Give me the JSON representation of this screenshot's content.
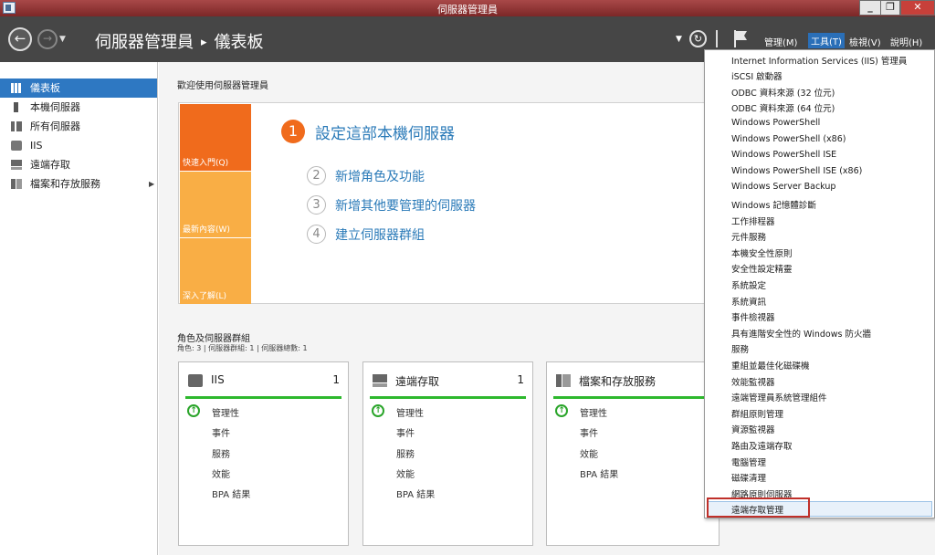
{
  "window": {
    "title": "伺服器管理員"
  },
  "header": {
    "app_name": "伺服器管理員",
    "separator": "▸",
    "page": "儀表板",
    "menus": {
      "manage": "管理(M)",
      "tools": "工具(T)",
      "view": "檢視(V)",
      "help": "說明(H)"
    }
  },
  "sidebar": {
    "items": [
      {
        "label": "儀表板"
      },
      {
        "label": "本機伺服器"
      },
      {
        "label": "所有伺服器"
      },
      {
        "label": "IIS"
      },
      {
        "label": "遠端存取"
      },
      {
        "label": "檔案和存放服務"
      }
    ]
  },
  "welcome": {
    "title": "歡迎使用伺服器管理員",
    "tiles": {
      "quick": "快速入門(Q)",
      "new": "最新內容(W)",
      "learn": "深入了解(L)"
    },
    "steps": [
      {
        "num": "1",
        "text": "設定這部本機伺服器"
      },
      {
        "num": "2",
        "text": "新增角色及功能"
      },
      {
        "num": "3",
        "text": "新增其他要管理的伺服器"
      },
      {
        "num": "4",
        "text": "建立伺服器群組"
      }
    ]
  },
  "roles": {
    "title": "角色及伺服器群組",
    "subtitle": "角色: 3 | 伺服器群組: 1 | 伺服器總數: 1",
    "cards": [
      {
        "name": "IIS",
        "count": "1",
        "rows": [
          "管理性",
          "事件",
          "服務",
          "效能",
          "BPA 結果"
        ]
      },
      {
        "name": "遠端存取",
        "count": "1",
        "rows": [
          "管理性",
          "事件",
          "服務",
          "效能",
          "BPA 結果"
        ]
      },
      {
        "name": "檔案和存放服務",
        "count": "",
        "rows": [
          "管理性",
          "事件",
          "效能",
          "BPA 結果"
        ]
      }
    ]
  },
  "tools_menu": {
    "items": [
      "Internet Information Services (IIS) 管理員",
      "iSCSI 啟動器",
      "ODBC 資料來源 (32 位元)",
      "ODBC 資料來源 (64 位元)",
      "Windows PowerShell",
      "Windows PowerShell (x86)",
      "Windows PowerShell ISE",
      "Windows PowerShell ISE (x86)",
      "Windows Server Backup",
      "Windows 記憶體診斷",
      "工作排程器",
      "元件服務",
      "本機安全性原則",
      "安全性設定精靈",
      "系統設定",
      "系統資訊",
      "事件檢視器",
      "具有進階安全性的 Windows 防火牆",
      "服務",
      "重組並最佳化磁碟機",
      "效能監視器",
      "遠端管理員系統管理組件",
      "群組原則管理",
      "資源監視器",
      "路由及遠端存取",
      "電腦管理",
      "磁碟清理",
      "網路原則伺服器",
      "遠端存取管理"
    ],
    "highlighted": "遠端存取管理"
  }
}
